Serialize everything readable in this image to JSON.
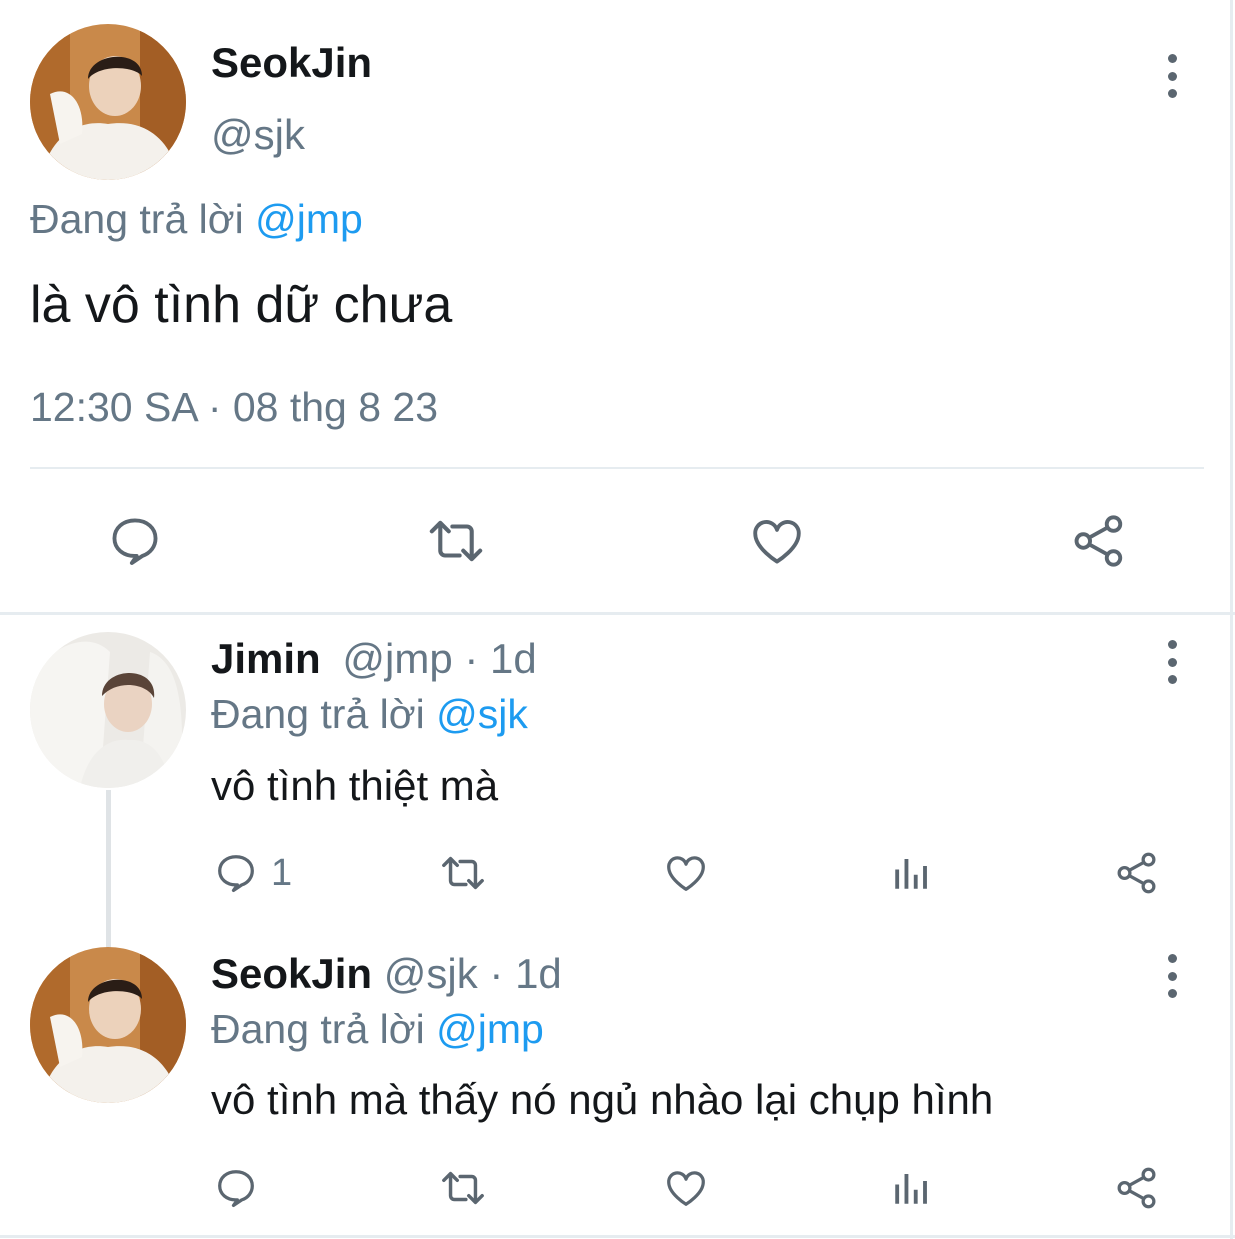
{
  "main_tweet": {
    "name": "SeokJin",
    "handle": "@sjk",
    "reply_prefix": "Đang trả lời",
    "reply_to": "@jmp",
    "text": "là vô tình dữ chưa",
    "timestamp": "12:30 SA · 08 thg 8 23",
    "actions": {
      "reply_icon": "reply-icon",
      "retweet_icon": "retweet-icon",
      "like_icon": "like-icon",
      "share_icon": "share-icon"
    }
  },
  "replies": [
    {
      "name": "Jimin",
      "handle": "@jmp",
      "sep": "·",
      "time": "1d",
      "reply_prefix": "Đang trả lời",
      "reply_to": "@sjk",
      "text": "vô tình thiệt mà",
      "reply_count": "1"
    },
    {
      "name": "SeokJin",
      "handle": "@sjk",
      "sep": "·",
      "time": "1d",
      "reply_prefix": "Đang trả lời",
      "reply_to": "@jmp",
      "text": "vô tình mà thấy nó ngủ nhào lại chụp hình",
      "reply_count": ""
    }
  ],
  "colors": {
    "text": "#14171a",
    "muted": "#657786",
    "link": "#1d9bf0",
    "icon": "#5b6670",
    "divider": "#e6ecf0"
  }
}
